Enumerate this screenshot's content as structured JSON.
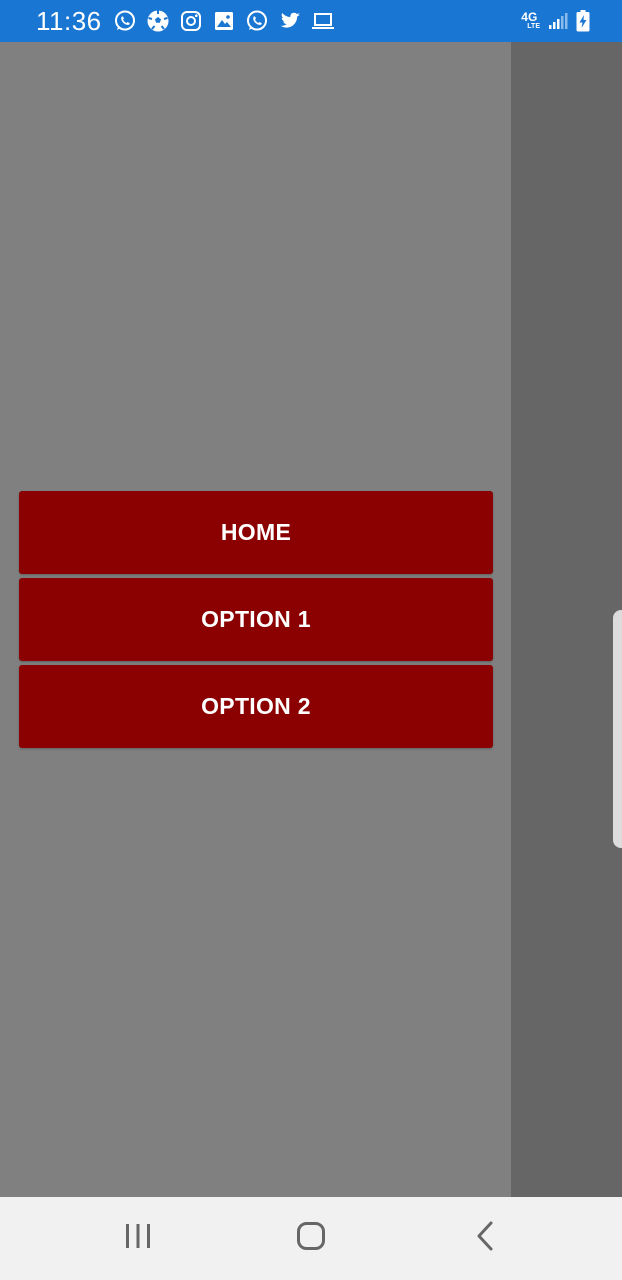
{
  "status_bar": {
    "time": "11:36",
    "left_icons": [
      "whatsapp-icon",
      "soccer-ball-icon",
      "instagram-icon",
      "gallery-icon",
      "whatsapp-icon",
      "twitter-icon",
      "laptop-icon"
    ],
    "network_label": "4G",
    "network_sublabel": "LTE",
    "battery_level": "charging",
    "background_color": "#1976d2"
  },
  "drawer": {
    "background_color": "#808080",
    "menu_items": [
      {
        "label": "HOME"
      },
      {
        "label": "OPTION 1"
      },
      {
        "label": "OPTION 2"
      }
    ],
    "button_color": "#8b0000"
  },
  "nav_bar": {
    "buttons": [
      "recent-apps-icon",
      "home-icon",
      "back-icon"
    ]
  }
}
